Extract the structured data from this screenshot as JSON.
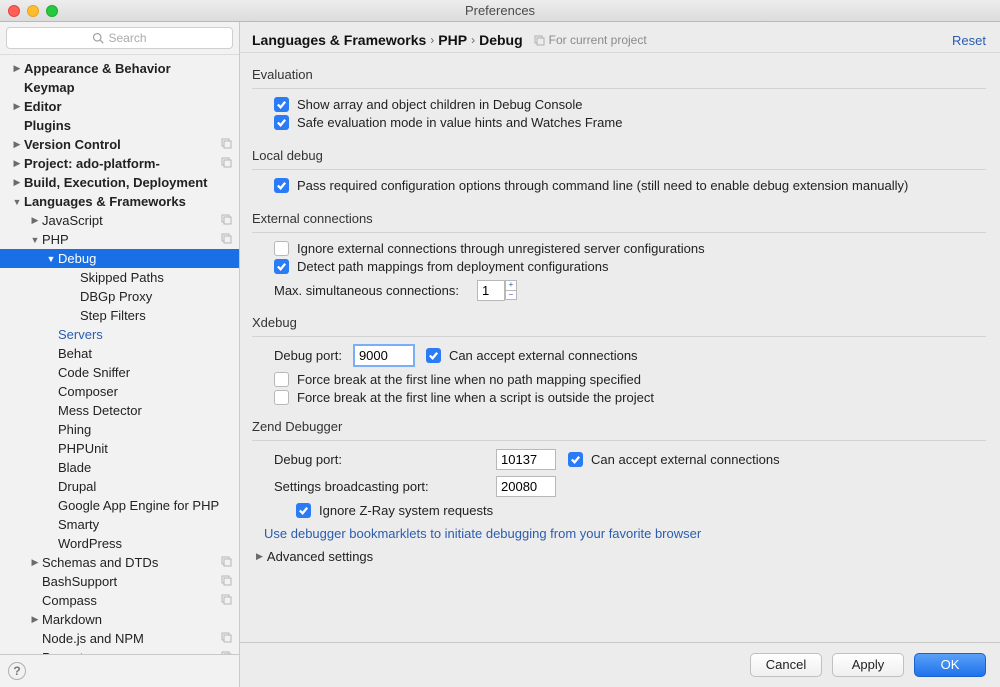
{
  "window": {
    "title": "Preferences"
  },
  "sidebar": {
    "search_placeholder": "Search",
    "items": [
      {
        "label": "Appearance & Behavior",
        "arrow": "right",
        "bold": true,
        "depth": 0
      },
      {
        "label": "Keymap",
        "depth": 0,
        "bold": true
      },
      {
        "label": "Editor",
        "arrow": "right",
        "bold": true,
        "depth": 0
      },
      {
        "label": "Plugins",
        "depth": 0,
        "bold": true
      },
      {
        "label": "Version Control",
        "arrow": "right",
        "bold": true,
        "depth": 0,
        "proj": true
      },
      {
        "label": "Project: ado-platform-",
        "arrow": "right",
        "bold": true,
        "depth": 0,
        "proj": true
      },
      {
        "label": "Build, Execution, Deployment",
        "arrow": "right",
        "bold": true,
        "depth": 0
      },
      {
        "label": "Languages & Frameworks",
        "arrow": "down",
        "bold": true,
        "depth": 0
      },
      {
        "label": "JavaScript",
        "arrow": "right",
        "depth": 1,
        "proj": true
      },
      {
        "label": "PHP",
        "arrow": "down",
        "depth": 1,
        "proj": true
      },
      {
        "label": "Debug",
        "arrow": "down",
        "depth": 2,
        "selected": true
      },
      {
        "label": "Skipped Paths",
        "depth": 3
      },
      {
        "label": "DBGp Proxy",
        "depth": 3
      },
      {
        "label": "Step Filters",
        "depth": 3
      },
      {
        "label": "Servers",
        "depth": 2,
        "link": true
      },
      {
        "label": "Behat",
        "depth": 2
      },
      {
        "label": "Code Sniffer",
        "depth": 2
      },
      {
        "label": "Composer",
        "depth": 2
      },
      {
        "label": "Mess Detector",
        "depth": 2
      },
      {
        "label": "Phing",
        "depth": 2
      },
      {
        "label": "PHPUnit",
        "depth": 2
      },
      {
        "label": "Blade",
        "depth": 2
      },
      {
        "label": "Drupal",
        "depth": 2
      },
      {
        "label": "Google App Engine for PHP",
        "depth": 2
      },
      {
        "label": "Smarty",
        "depth": 2
      },
      {
        "label": "WordPress",
        "depth": 2
      },
      {
        "label": "Schemas and DTDs",
        "arrow": "right",
        "depth": 1,
        "proj": true
      },
      {
        "label": "BashSupport",
        "depth": 1,
        "proj": true
      },
      {
        "label": "Compass",
        "depth": 1,
        "proj": true
      },
      {
        "label": "Markdown",
        "arrow": "right",
        "depth": 1
      },
      {
        "label": "Node.js and NPM",
        "depth": 1,
        "proj": true
      },
      {
        "label": "Puppet",
        "arrow": "right",
        "depth": 1,
        "proj": true
      }
    ]
  },
  "breadcrumb": {
    "p0": "Languages & Frameworks",
    "p1": "PHP",
    "p2": "Debug",
    "for_project": "For current project",
    "reset": "Reset"
  },
  "evaluation": {
    "title": "Evaluation",
    "opt1": "Show array and object children in Debug Console",
    "opt2": "Safe evaluation mode in value hints and Watches Frame"
  },
  "local_debug": {
    "title": "Local debug",
    "opt1": "Pass required configuration options through command line (still need to enable debug extension manually)"
  },
  "external": {
    "title": "External connections",
    "opt1": "Ignore external connections through unregistered server configurations",
    "opt2": "Detect path mappings from deployment configurations",
    "max_label": "Max. simultaneous connections:",
    "max_value": "1"
  },
  "xdebug": {
    "title": "Xdebug",
    "port_label": "Debug port:",
    "port_value": "9000",
    "accept": "Can accept external connections",
    "fb1": "Force break at the first line when no path mapping specified",
    "fb2": "Force break at the first line when a script is outside the project"
  },
  "zend": {
    "title": "Zend Debugger",
    "port_label": "Debug port:",
    "port_value": "10137",
    "accept": "Can accept external connections",
    "bcast_label": "Settings broadcasting port:",
    "bcast_value": "20080",
    "ignore_zray": "Ignore Z-Ray system requests"
  },
  "bookmarklets_link": "Use debugger bookmarklets to initiate debugging from your favorite browser",
  "advanced": "Advanced settings",
  "buttons": {
    "cancel": "Cancel",
    "apply": "Apply",
    "ok": "OK"
  }
}
